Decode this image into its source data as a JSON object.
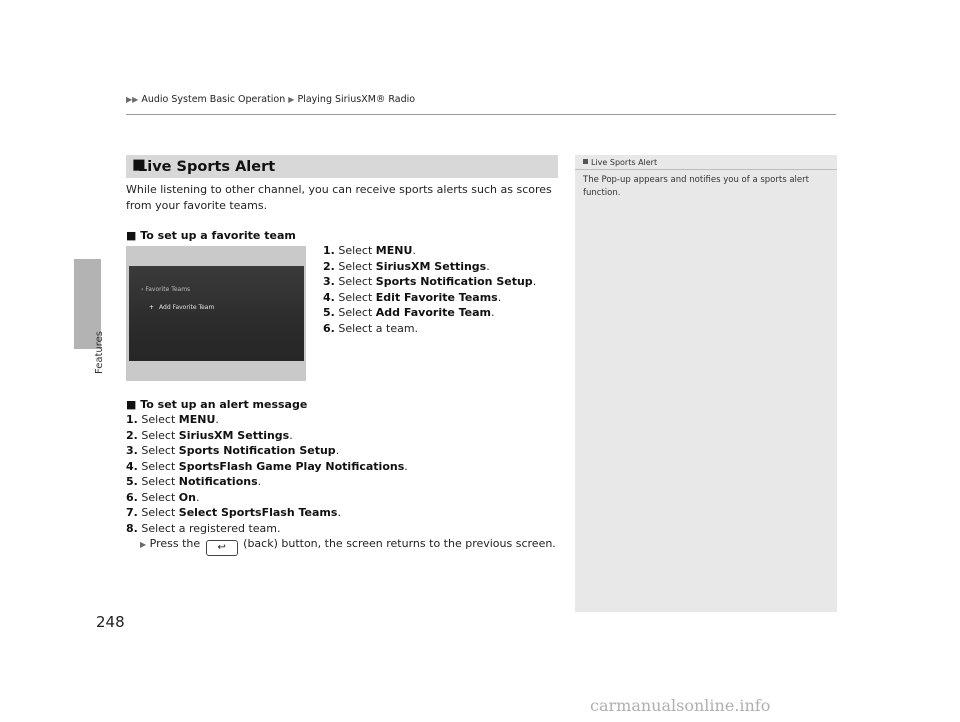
{
  "breadcrumb": {
    "items": [
      "Audio System Basic Operation",
      "Playing SiriusXM® Radio"
    ]
  },
  "side_tab": {
    "label": "Features"
  },
  "page_number": "248",
  "section": {
    "title": "Live Sports Alert",
    "intro": "While listening to other channel, you can receive sports alerts such as scores from your favorite teams."
  },
  "favorite_team": {
    "heading": "To set up a favorite team",
    "steps": [
      {
        "num": "1.",
        "pre": "Select ",
        "bold": "MENU",
        "post": "."
      },
      {
        "num": "2.",
        "pre": "Select ",
        "bold": "SiriusXM Settings",
        "post": "."
      },
      {
        "num": "3.",
        "pre": "Select ",
        "bold": "Sports Notification Setup",
        "post": "."
      },
      {
        "num": "4.",
        "pre": "Select ",
        "bold": "Edit Favorite Teams",
        "post": "."
      },
      {
        "num": "5.",
        "pre": "Select ",
        "bold": "Add Favorite Team",
        "post": "."
      },
      {
        "num": "6.",
        "pre": "Select a team.",
        "bold": "",
        "post": ""
      }
    ],
    "screen": {
      "crumb": "Favorite Teams",
      "item": "Add Favorite Team"
    }
  },
  "alert_message": {
    "heading": "To set up an alert message",
    "steps": [
      {
        "num": "1.",
        "pre": "Select ",
        "bold": "MENU",
        "post": "."
      },
      {
        "num": "2.",
        "pre": "Select ",
        "bold": "SiriusXM Settings",
        "post": "."
      },
      {
        "num": "3.",
        "pre": "Select ",
        "bold": "Sports Notification Setup",
        "post": "."
      },
      {
        "num": "4.",
        "pre": "Select ",
        "bold": "SportsFlash Game Play Notifications",
        "post": "."
      },
      {
        "num": "5.",
        "pre": "Select ",
        "bold": "Notifications",
        "post": "."
      },
      {
        "num": "6.",
        "pre": "Select ",
        "bold": "On",
        "post": "."
      },
      {
        "num": "7.",
        "pre": "Select ",
        "bold": "Select SportsFlash Teams",
        "post": "."
      },
      {
        "num": "8.",
        "pre": "Select a registered team.",
        "bold": "",
        "post": ""
      }
    ],
    "note_pre": "Press the",
    "note_post": "(back) button, the screen returns to the previous screen."
  },
  "side_note": {
    "heading": "Live Sports Alert",
    "text": "The Pop-up appears and notifies you of a sports alert function."
  },
  "watermark": "carmanualsonline.info"
}
